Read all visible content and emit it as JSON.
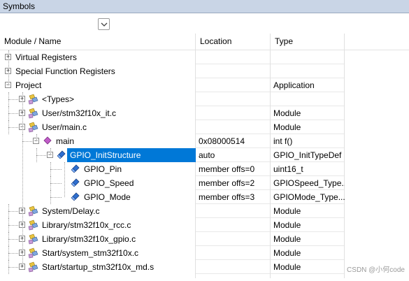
{
  "window": {
    "title": "Symbols"
  },
  "filter": {
    "dropdown_icon": "chevron-down-icon"
  },
  "columns": [
    "Module / Name",
    "Location",
    "Type"
  ],
  "rows": [
    {
      "depth": 0,
      "toggle": "+",
      "icon": "",
      "name": "Virtual Registers",
      "location": "",
      "type": ""
    },
    {
      "depth": 0,
      "toggle": "+",
      "icon": "",
      "name": "Special Function Registers",
      "location": "",
      "type": ""
    },
    {
      "depth": 0,
      "toggle": "-",
      "icon": "",
      "name": "Project",
      "location": "",
      "type": "Application"
    },
    {
      "depth": 1,
      "toggle": "+",
      "icon": "module-icon",
      "name": "<Types>",
      "location": "",
      "type": ""
    },
    {
      "depth": 1,
      "toggle": "+",
      "icon": "module-icon",
      "name": "User/stm32f10x_it.c",
      "location": "",
      "type": "Module"
    },
    {
      "depth": 1,
      "toggle": "-",
      "icon": "module-icon",
      "name": "User/main.c",
      "location": "",
      "type": "Module"
    },
    {
      "depth": 2,
      "toggle": "-",
      "icon": "function-icon",
      "name": "main",
      "location": "0x08000514",
      "type": "int f()"
    },
    {
      "depth": 3,
      "toggle": "-",
      "icon": "variable-icon",
      "name": "GPIO_InitStructure",
      "location": "auto",
      "type": "GPIO_InitTypeDef",
      "selected": true
    },
    {
      "depth": 4,
      "toggle": "",
      "icon": "variable-icon",
      "name": "GPIO_Pin",
      "location": "member offs=0",
      "type": "uint16_t"
    },
    {
      "depth": 4,
      "toggle": "",
      "icon": "variable-icon",
      "name": "GPIO_Speed",
      "location": "member offs=2",
      "type": "GPIOSpeed_Type..."
    },
    {
      "depth": 4,
      "toggle": "",
      "icon": "variable-icon",
      "name": "GPIO_Mode",
      "location": "member offs=3",
      "type": "GPIOMode_Type..."
    },
    {
      "depth": 1,
      "toggle": "+",
      "icon": "module-icon",
      "name": "System/Delay.c",
      "location": "",
      "type": "Module"
    },
    {
      "depth": 1,
      "toggle": "+",
      "icon": "module-icon",
      "name": "Library/stm32f10x_rcc.c",
      "location": "",
      "type": "Module"
    },
    {
      "depth": 1,
      "toggle": "+",
      "icon": "module-icon",
      "name": "Library/stm32f10x_gpio.c",
      "location": "",
      "type": "Module"
    },
    {
      "depth": 1,
      "toggle": "+",
      "icon": "module-icon",
      "name": "Start/system_stm32f10x.c",
      "location": "",
      "type": "Module"
    },
    {
      "depth": 1,
      "toggle": "+",
      "icon": "module-icon",
      "name": "Start/startup_stm32f10x_md.s",
      "location": "",
      "type": "Module"
    }
  ],
  "watermark": "CSDN @小何code",
  "colors": {
    "selection": "#0078d7",
    "titlebar": "#c9d5e6"
  }
}
